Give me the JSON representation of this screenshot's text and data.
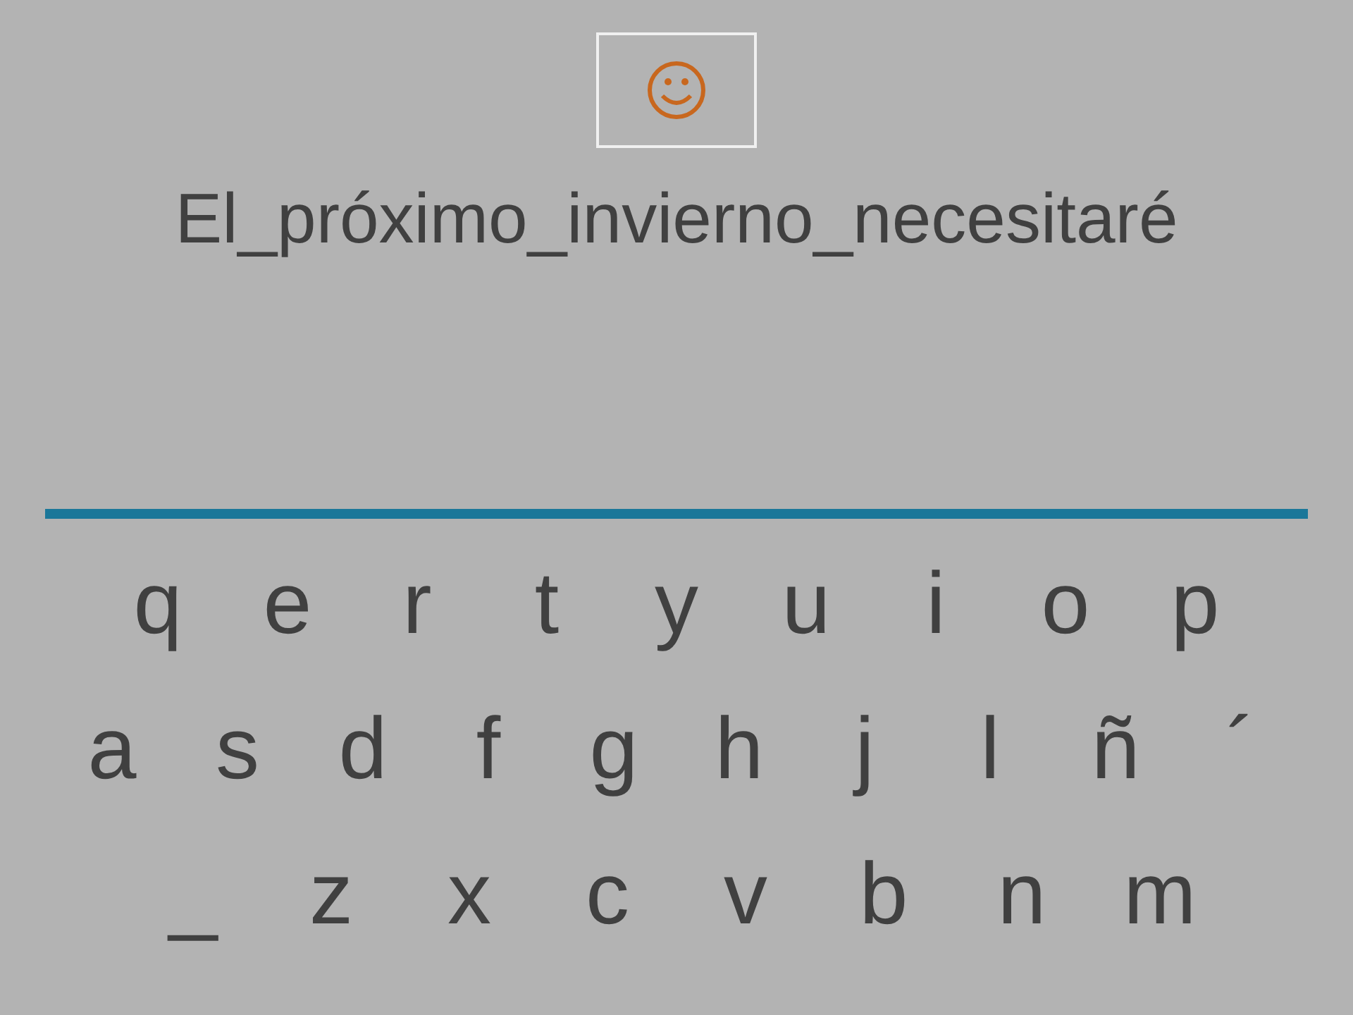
{
  "sentence": "El_próximo_invierno_necesitaré",
  "keyboard": [
    [
      "q",
      "e",
      "r",
      "t",
      "y",
      "u",
      "i",
      "o",
      "p"
    ],
    [
      "a",
      "s",
      "d",
      "f",
      "g",
      "h",
      "j",
      "l",
      "ñ",
      "´"
    ],
    [
      "_",
      "z",
      "x",
      "c",
      "v",
      "b",
      "n",
      "m"
    ]
  ]
}
